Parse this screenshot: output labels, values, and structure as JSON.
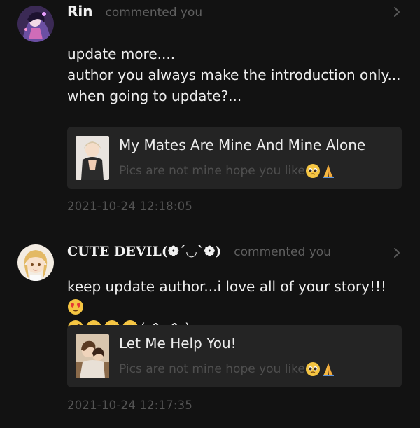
{
  "comments": [
    {
      "username": "Rin",
      "action": "commented you",
      "body_lines": [
        "update more....",
        "author you always make the introduction only...",
        "when going to update?..."
      ],
      "story": {
        "title": "My Mates Are Mine And Mine Alone",
        "subtitle": "Pics are not mine hope you like"
      },
      "timestamp": "2021-10-24 12:18:05",
      "avatar_icon": "anime-avatar-purple",
      "emojis": [
        "pleading-face",
        "folded-hands"
      ]
    },
    {
      "username": "CUTE DEVIL(❁´◡`❁)",
      "action": "commented you",
      "body_line1": "keep update author...i love all of your story!!!",
      "body_line2_suffix": "( ^_^ )",
      "story": {
        "title": "Let Me Help You!",
        "subtitle": "Pics are not mine hope you like"
      },
      "timestamp": "2021-10-24 12:17:35",
      "avatar_icon": "anime-avatar-blonde",
      "emojis_line1": [
        "heart-eyes-face"
      ],
      "emojis_line2": [
        "kissing-face",
        "pleading-face",
        "pleading-face",
        "pleading-face"
      ],
      "story_emojis": [
        "pleading-face",
        "folded-hands"
      ]
    }
  ],
  "colors": {
    "background": "#121212",
    "card": "#242424",
    "muted_text": "#5f5f5f",
    "primary_text": "#efefef"
  }
}
